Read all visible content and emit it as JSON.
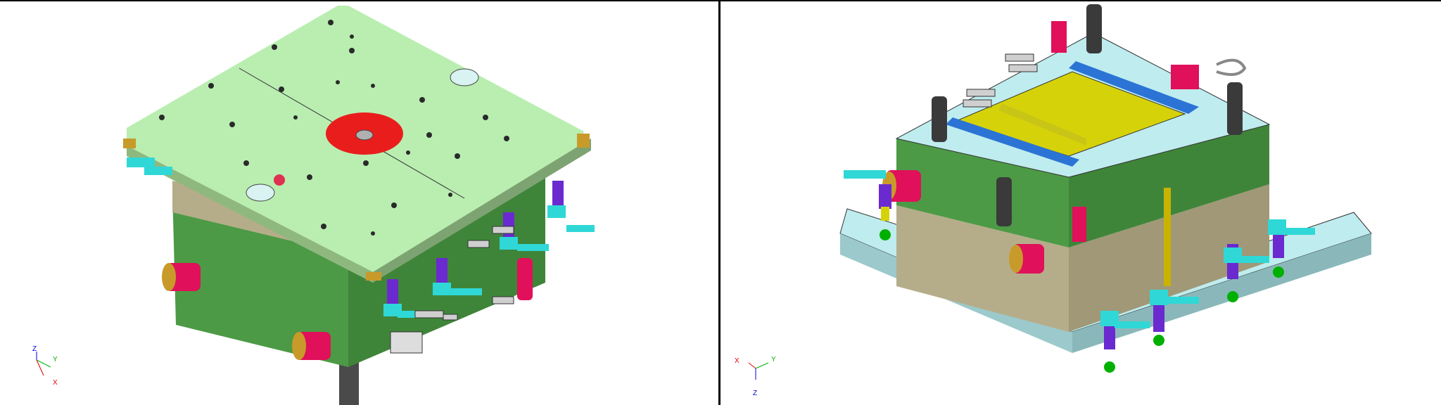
{
  "colors": {
    "plate_top": "#b9eeb0",
    "plate_side": "#8fb87f",
    "mold_body": "#4c9a45",
    "mold_body_dark": "#3c7f37",
    "mold_plate_tan": "#b5ad8a",
    "base_plate": "#bfecee",
    "cavity_yellow": "#d6d20a",
    "insert_blue": "#2b74d6",
    "locating_ring_red": "#ea1d1d",
    "cylinder_magenta": "#e0105a",
    "coupling_cyan": "#2fd8d6",
    "coupling_purple": "#6a2ad0",
    "pin_dark": "#3a3a3a",
    "axis_x": "#e00000",
    "axis_y": "#00b000",
    "axis_z": "#0000e0"
  },
  "views": {
    "left": {
      "name": "mold-assembly-top-view",
      "triad": {
        "x": "X",
        "y": "Y",
        "z": "Z"
      }
    },
    "right": {
      "name": "mold-assembly-open-cavity-view",
      "triad": {
        "x": "X",
        "y": "Y",
        "z": "Z"
      }
    }
  }
}
